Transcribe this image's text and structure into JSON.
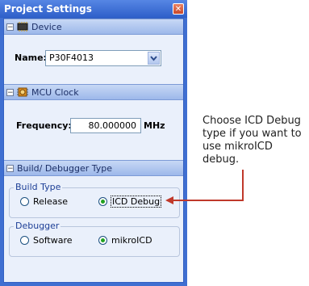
{
  "window": {
    "title": "Project Settings",
    "close_glyph": "✕"
  },
  "sections": {
    "device": {
      "title": "Device",
      "icon": "chip-icon",
      "expander": "−"
    },
    "mcu_clock": {
      "title": "MCU Clock",
      "icon": "clock-chip-icon",
      "expander": "−"
    },
    "build": {
      "title": "Build/ Debugger Type",
      "expander": "−"
    }
  },
  "device": {
    "name_label": "Name:",
    "name_value": "P30F4013"
  },
  "clock": {
    "frequency_label": "Frequency:",
    "frequency_value": "80.000000",
    "unit": "MHz"
  },
  "build_type": {
    "legend": "Build Type",
    "options": [
      {
        "label": "Release",
        "checked": false
      },
      {
        "label": "ICD Debug",
        "checked": true
      }
    ]
  },
  "debugger": {
    "legend": "Debugger",
    "options": [
      {
        "label": "Software",
        "checked": false
      },
      {
        "label": "mikroICD",
        "checked": true
      }
    ]
  },
  "annotation": {
    "text": "Choose ICD Debug type if you want to use mikroICD debug.",
    "arrow_color": "#c0392b"
  },
  "colors": {
    "title_bar": "#2e5fc9",
    "panel_bg": "#eaf0fb",
    "radio_dot": "#21a121"
  }
}
